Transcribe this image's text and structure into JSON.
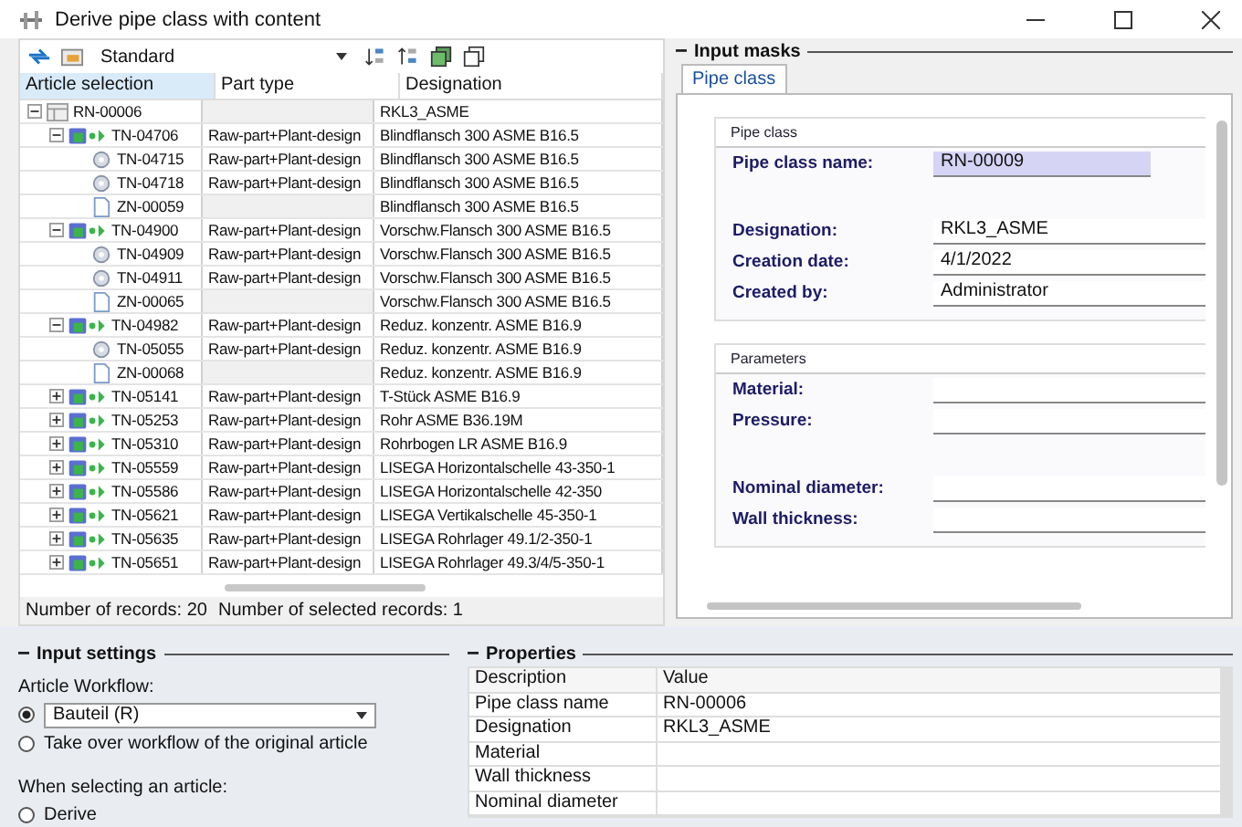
{
  "window": {
    "title": "Derive pipe class with content"
  },
  "toolbar": {
    "view": "Standard"
  },
  "article_table": {
    "columns": [
      "Article selection",
      "Part type",
      "Designation"
    ],
    "rows": [
      {
        "kind": "class",
        "article": "RN-00006",
        "designation": "RKL3_ASME",
        "expanded": true,
        "children": [
          {
            "kind": "assembly",
            "article": "TN-04706",
            "part_type": "Raw-part+Plant-design",
            "designation": "Blindflansch 300 ASME B16.5",
            "expanded": true,
            "children": [
              {
                "kind": "part",
                "article": "TN-04715",
                "part_type": "Raw-part+Plant-design",
                "designation": "Blindflansch 300 ASME B16.5"
              },
              {
                "kind": "part",
                "article": "TN-04718",
                "part_type": "Raw-part+Plant-design",
                "designation": "Blindflansch 300 ASME B16.5"
              },
              {
                "kind": "document",
                "article": "ZN-00059",
                "designation": "Blindflansch 300 ASME B16.5"
              }
            ]
          },
          {
            "kind": "assembly",
            "article": "TN-04900",
            "part_type": "Raw-part+Plant-design",
            "designation": "Vorschw.Flansch 300 ASME B16.5",
            "expanded": true,
            "children": [
              {
                "kind": "part",
                "article": "TN-04909",
                "part_type": "Raw-part+Plant-design",
                "designation": "Vorschw.Flansch 300 ASME B16.5"
              },
              {
                "kind": "part",
                "article": "TN-04911",
                "part_type": "Raw-part+Plant-design",
                "designation": "Vorschw.Flansch 300 ASME B16.5"
              },
              {
                "kind": "document",
                "article": "ZN-00065",
                "designation": "Vorschw.Flansch 300 ASME B16.5"
              }
            ]
          },
          {
            "kind": "assembly",
            "article": "TN-04982",
            "part_type": "Raw-part+Plant-design",
            "designation": "Reduz. konzentr. ASME B16.9",
            "expanded": true,
            "children": [
              {
                "kind": "part",
                "article": "TN-05055",
                "part_type": "Raw-part+Plant-design",
                "designation": "Reduz. konzentr. ASME B16.9"
              },
              {
                "kind": "document",
                "article": "ZN-00068",
                "designation": "Reduz. konzentr. ASME B16.9"
              }
            ]
          },
          {
            "kind": "assembly",
            "article": "TN-05141",
            "part_type": "Raw-part+Plant-design",
            "designation": "T-Stück ASME B16.9",
            "expanded": false
          },
          {
            "kind": "assembly",
            "article": "TN-05253",
            "part_type": "Raw-part+Plant-design",
            "designation": "Rohr ASME B36.19M",
            "expanded": false
          },
          {
            "kind": "assembly",
            "article": "TN-05310",
            "part_type": "Raw-part+Plant-design",
            "designation": "Rohrbogen LR ASME B16.9",
            "expanded": false
          },
          {
            "kind": "assembly",
            "article": "TN-05559",
            "part_type": "Raw-part+Plant-design",
            "designation": "LISEGA Horizontalschelle 43-350-1",
            "expanded": false
          },
          {
            "kind": "assembly",
            "article": "TN-05586",
            "part_type": "Raw-part+Plant-design",
            "designation": "LISEGA Horizontalschelle 42-350",
            "expanded": false
          },
          {
            "kind": "assembly",
            "article": "TN-05621",
            "part_type": "Raw-part+Plant-design",
            "designation": "LISEGA Vertikalschelle 45-350-1",
            "expanded": false
          },
          {
            "kind": "assembly",
            "article": "TN-05635",
            "part_type": "Raw-part+Plant-design",
            "designation": "LISEGA Rohrlager 49.1/2-350-1",
            "expanded": false
          },
          {
            "kind": "assembly",
            "article": "TN-05651",
            "part_type": "Raw-part+Plant-design",
            "designation": "LISEGA Rohrlager 49.3/4/5-350-1",
            "expanded": false
          }
        ]
      }
    ]
  },
  "status": [
    "Number of records: 20",
    "Number of selected records: 1"
  ],
  "input_masks": {
    "title": "Input masks",
    "tabs": [
      {
        "label": "Pipe class",
        "selected": true
      }
    ],
    "groups": [
      {
        "title": "Pipe class",
        "fields": [
          {
            "label": "Pipe class name:",
            "value": "RN-00009",
            "focused": true,
            "gap_after": true
          },
          {
            "label": "Designation:",
            "value": "RKL3_ASME",
            "focused": false
          },
          {
            "label": "Creation date:",
            "value": "4/1/2022",
            "focused": false
          },
          {
            "label": "Created by:",
            "value": "Administrator",
            "focused": false
          }
        ]
      },
      {
        "title": "Parameters",
        "fields": [
          {
            "label": "Material:",
            "focused": false
          },
          {
            "label": "Pressure:",
            "focused": false,
            "gap_after": true
          },
          {
            "label": "Nominal diameter:",
            "focused": false
          },
          {
            "label": "Wall thickness:",
            "focused": false
          }
        ]
      }
    ]
  },
  "input_settings": {
    "title": "Input settings",
    "workflow_label": "Article Workflow:",
    "workflow_options": [
      {
        "kind": "dropdown",
        "label": "Bauteil (R)",
        "selected": true
      },
      {
        "kind": "text",
        "label": "Take over workflow of the original article",
        "selected": false
      }
    ],
    "select_label": "When selecting an article:",
    "select_options": [
      {
        "kind": "text",
        "label": "Derive",
        "selected": false
      }
    ]
  },
  "properties": {
    "title": "Properties",
    "columns": [
      "Description",
      "Value"
    ],
    "rows": [
      {
        "description": "Pipe class name",
        "value": "RN-00006"
      },
      {
        "description": "Designation",
        "value": "RKL3_ASME"
      },
      {
        "description": "Material"
      },
      {
        "description": "Wall thickness"
      },
      {
        "description": "Nominal diameter"
      }
    ]
  }
}
